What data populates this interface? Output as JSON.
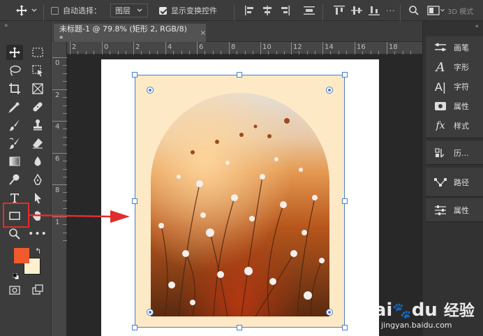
{
  "options_bar": {
    "auto_select_label": "自动选择：",
    "auto_select_checked": false,
    "layer_select_value": "图层",
    "show_transform_label": "显示变换控件",
    "show_transform_checked": true,
    "mode_label": "3D 模式"
  },
  "document_tab": {
    "title": "未标题-1 @ 79.8% (矩形 2, RGB/8) *",
    "close_glyph": "×"
  },
  "ruler_h": [
    "2",
    "0",
    "2",
    "4",
    "6",
    "8",
    "10",
    "12",
    "14",
    "16",
    "18"
  ],
  "ruler_v": [
    "0",
    "2",
    "4",
    "6",
    "8",
    "1"
  ],
  "tools": {
    "foreground_color": "#f15a2b",
    "background_color": "#fdf0cf"
  },
  "panels": [
    {
      "label": "画笔",
      "icon": "brush-settings-icon"
    },
    {
      "label": "字形",
      "icon": "glyphs-icon"
    },
    {
      "label": "字符",
      "icon": "character-icon"
    },
    {
      "label": "属性",
      "icon": "properties-icon"
    },
    {
      "label": "样式",
      "icon": "styles-icon"
    },
    {
      "label": "历...",
      "icon": "history-icon"
    },
    {
      "label": "路径",
      "icon": "paths-icon"
    },
    {
      "label": "属性",
      "icon": "adjust-properties-icon"
    }
  ],
  "colors": {
    "accent_red": "#e22d2d",
    "selection_blue": "#4a7dc8",
    "rect_fill": "#fde9c6"
  },
  "watermark": {
    "brand": "Bai",
    "brand2": "du",
    "cn": "经验",
    "url": "jingyan.baidu.com"
  }
}
